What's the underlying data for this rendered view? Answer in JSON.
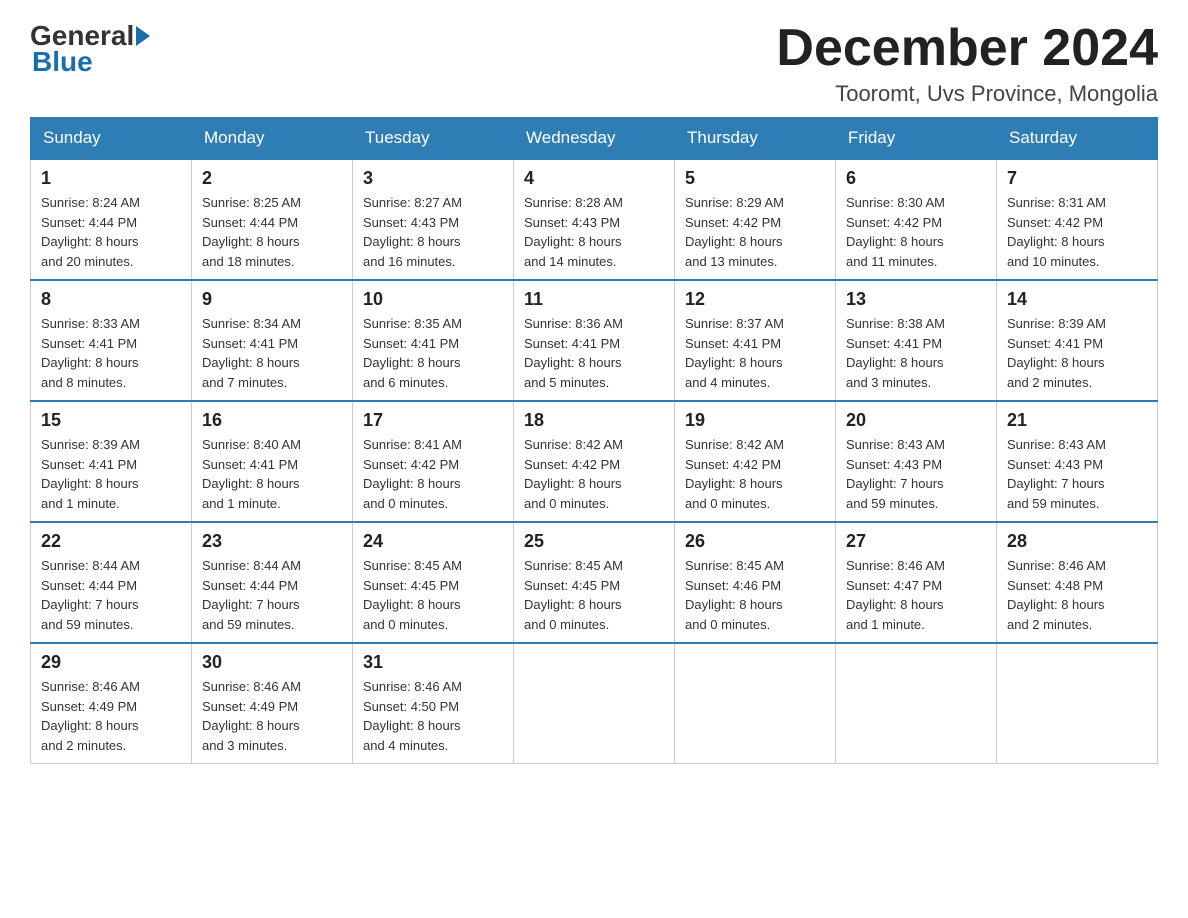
{
  "header": {
    "logo_general": "General",
    "logo_blue": "Blue",
    "month_title": "December 2024",
    "location": "Tooromt, Uvs Province, Mongolia"
  },
  "days_of_week": [
    "Sunday",
    "Monday",
    "Tuesday",
    "Wednesday",
    "Thursday",
    "Friday",
    "Saturday"
  ],
  "weeks": [
    [
      {
        "day": "1",
        "sunrise": "8:24 AM",
        "sunset": "4:44 PM",
        "daylight": "8 hours and 20 minutes."
      },
      {
        "day": "2",
        "sunrise": "8:25 AM",
        "sunset": "4:44 PM",
        "daylight": "8 hours and 18 minutes."
      },
      {
        "day": "3",
        "sunrise": "8:27 AM",
        "sunset": "4:43 PM",
        "daylight": "8 hours and 16 minutes."
      },
      {
        "day": "4",
        "sunrise": "8:28 AM",
        "sunset": "4:43 PM",
        "daylight": "8 hours and 14 minutes."
      },
      {
        "day": "5",
        "sunrise": "8:29 AM",
        "sunset": "4:42 PM",
        "daylight": "8 hours and 13 minutes."
      },
      {
        "day": "6",
        "sunrise": "8:30 AM",
        "sunset": "4:42 PM",
        "daylight": "8 hours and 11 minutes."
      },
      {
        "day": "7",
        "sunrise": "8:31 AM",
        "sunset": "4:42 PM",
        "daylight": "8 hours and 10 minutes."
      }
    ],
    [
      {
        "day": "8",
        "sunrise": "8:33 AM",
        "sunset": "4:41 PM",
        "daylight": "8 hours and 8 minutes."
      },
      {
        "day": "9",
        "sunrise": "8:34 AM",
        "sunset": "4:41 PM",
        "daylight": "8 hours and 7 minutes."
      },
      {
        "day": "10",
        "sunrise": "8:35 AM",
        "sunset": "4:41 PM",
        "daylight": "8 hours and 6 minutes."
      },
      {
        "day": "11",
        "sunrise": "8:36 AM",
        "sunset": "4:41 PM",
        "daylight": "8 hours and 5 minutes."
      },
      {
        "day": "12",
        "sunrise": "8:37 AM",
        "sunset": "4:41 PM",
        "daylight": "8 hours and 4 minutes."
      },
      {
        "day": "13",
        "sunrise": "8:38 AM",
        "sunset": "4:41 PM",
        "daylight": "8 hours and 3 minutes."
      },
      {
        "day": "14",
        "sunrise": "8:39 AM",
        "sunset": "4:41 PM",
        "daylight": "8 hours and 2 minutes."
      }
    ],
    [
      {
        "day": "15",
        "sunrise": "8:39 AM",
        "sunset": "4:41 PM",
        "daylight": "8 hours and 1 minute."
      },
      {
        "day": "16",
        "sunrise": "8:40 AM",
        "sunset": "4:41 PM",
        "daylight": "8 hours and 1 minute."
      },
      {
        "day": "17",
        "sunrise": "8:41 AM",
        "sunset": "4:42 PM",
        "daylight": "8 hours and 0 minutes."
      },
      {
        "day": "18",
        "sunrise": "8:42 AM",
        "sunset": "4:42 PM",
        "daylight": "8 hours and 0 minutes."
      },
      {
        "day": "19",
        "sunrise": "8:42 AM",
        "sunset": "4:42 PM",
        "daylight": "8 hours and 0 minutes."
      },
      {
        "day": "20",
        "sunrise": "8:43 AM",
        "sunset": "4:43 PM",
        "daylight": "7 hours and 59 minutes."
      },
      {
        "day": "21",
        "sunrise": "8:43 AM",
        "sunset": "4:43 PM",
        "daylight": "7 hours and 59 minutes."
      }
    ],
    [
      {
        "day": "22",
        "sunrise": "8:44 AM",
        "sunset": "4:44 PM",
        "daylight": "7 hours and 59 minutes."
      },
      {
        "day": "23",
        "sunrise": "8:44 AM",
        "sunset": "4:44 PM",
        "daylight": "7 hours and 59 minutes."
      },
      {
        "day": "24",
        "sunrise": "8:45 AM",
        "sunset": "4:45 PM",
        "daylight": "8 hours and 0 minutes."
      },
      {
        "day": "25",
        "sunrise": "8:45 AM",
        "sunset": "4:45 PM",
        "daylight": "8 hours and 0 minutes."
      },
      {
        "day": "26",
        "sunrise": "8:45 AM",
        "sunset": "4:46 PM",
        "daylight": "8 hours and 0 minutes."
      },
      {
        "day": "27",
        "sunrise": "8:46 AM",
        "sunset": "4:47 PM",
        "daylight": "8 hours and 1 minute."
      },
      {
        "day": "28",
        "sunrise": "8:46 AM",
        "sunset": "4:48 PM",
        "daylight": "8 hours and 2 minutes."
      }
    ],
    [
      {
        "day": "29",
        "sunrise": "8:46 AM",
        "sunset": "4:49 PM",
        "daylight": "8 hours and 2 minutes."
      },
      {
        "day": "30",
        "sunrise": "8:46 AM",
        "sunset": "4:49 PM",
        "daylight": "8 hours and 3 minutes."
      },
      {
        "day": "31",
        "sunrise": "8:46 AM",
        "sunset": "4:50 PM",
        "daylight": "8 hours and 4 minutes."
      },
      null,
      null,
      null,
      null
    ]
  ],
  "labels": {
    "sunrise": "Sunrise:",
    "sunset": "Sunset:",
    "daylight": "Daylight:"
  }
}
